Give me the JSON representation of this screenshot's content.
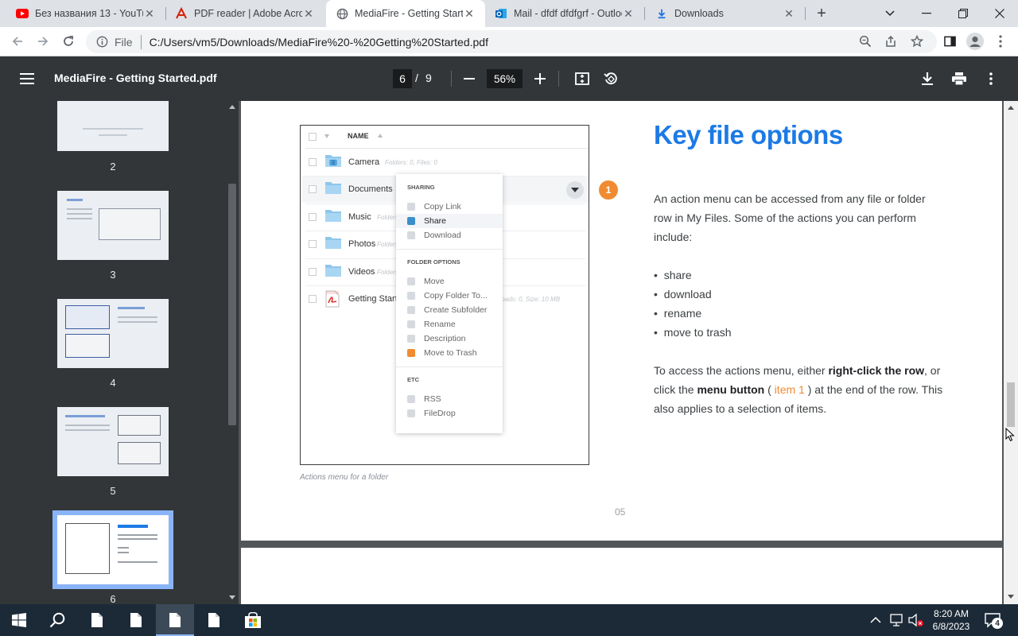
{
  "browser": {
    "tabs": [
      {
        "title": "Без названия 13 - YouTube",
        "icon": "youtube-icon",
        "active": false
      },
      {
        "title": "PDF reader | Adobe Acrobat",
        "icon": "adobe-acrobat-icon",
        "active": false
      },
      {
        "title": "MediaFire - Getting Started",
        "icon": "globe-icon",
        "active": true
      },
      {
        "title": "Mail - dfdf dfdfgrf - Outlook",
        "icon": "outlook-icon",
        "active": false
      },
      {
        "title": "Downloads",
        "icon": "download-icon",
        "active": false
      }
    ],
    "address": {
      "scheme_label": "File",
      "url": "C:/Users/vm5/Downloads/MediaFire%20-%20Getting%20Started.pdf"
    }
  },
  "viewer": {
    "doc_title": "MediaFire - Getting Started.pdf",
    "current_page": "6",
    "page_separator": "/",
    "total_pages": "9",
    "zoom": "56%"
  },
  "thumbnails": [
    {
      "label": "2"
    },
    {
      "label": "3"
    },
    {
      "label": "4"
    },
    {
      "label": "5"
    },
    {
      "label": "6",
      "selected": true
    }
  ],
  "page": {
    "heading": "Key file options",
    "intro": "An action menu can be accessed from any file or folder row in My Files. Some of the actions you can perform include:",
    "bullets": [
      "share",
      "download",
      "rename",
      "move to trash"
    ],
    "para_prefix": "To access the actions menu, either ",
    "para_bold1": "right-click the row",
    "para_mid": ", or click the ",
    "para_bold2": "menu button",
    "para_paren_open": " ( ",
    "para_item": "item 1",
    "para_paren_close": " )",
    "para_suffix": " at the end of the row. This also applies to a selection of items.",
    "caption": "Actions menu for a folder",
    "page_number": "05",
    "callout_number": "1",
    "accent_color": "#1c7ae5",
    "callout_color": "#f08b31"
  },
  "figure": {
    "column_header": "NAME",
    "rows": [
      {
        "name": "Camera",
        "meta": "Folders: 0, Files: 0",
        "type": "folder"
      },
      {
        "name": "Documents",
        "meta": "",
        "type": "folder"
      },
      {
        "name": "Music",
        "meta": "Folders",
        "type": "folder"
      },
      {
        "name": "Photos",
        "meta": "Folders",
        "type": "folder"
      },
      {
        "name": "Videos",
        "meta": "Folders",
        "type": "folder"
      },
      {
        "name": "Getting Start",
        "meta": "Downloads: 0, Size: 10 MB",
        "type": "pdf"
      }
    ],
    "menu": {
      "sections": [
        {
          "title": "SHARING",
          "items": [
            "Copy Link",
            "Share",
            "Download"
          ]
        },
        {
          "title": "FOLDER OPTIONS",
          "items": [
            "Move",
            "Copy Folder To...",
            "Create Subfolder",
            "Rename",
            "Description",
            "Move to Trash"
          ]
        },
        {
          "title": "ETC",
          "items": [
            "RSS",
            "FileDrop"
          ]
        }
      ]
    }
  },
  "taskbar": {
    "time": "8:20 AM",
    "date": "6/8/2023",
    "notification_count": "4"
  }
}
